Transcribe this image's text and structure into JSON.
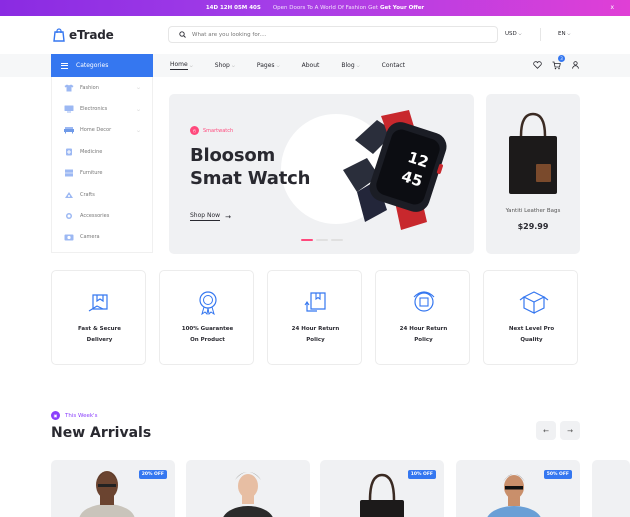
{
  "promo": {
    "countdown": "14D 12H 05M 40S",
    "message": "Open Doors To A World Of Fashion Get",
    "offer": "Get Your Offer",
    "close": "x"
  },
  "header": {
    "logo": "eTrade",
    "search_placeholder": "What are you looking for....",
    "currency": "USD",
    "language": "EN"
  },
  "nav": {
    "categories_label": "Categories",
    "items": [
      {
        "label": "Home",
        "dropdown": true
      },
      {
        "label": "Shop",
        "dropdown": true
      },
      {
        "label": "Pages",
        "dropdown": true
      },
      {
        "label": "About",
        "dropdown": false
      },
      {
        "label": "Blog",
        "dropdown": true
      },
      {
        "label": "Contact",
        "dropdown": false
      }
    ],
    "cart_count": "3"
  },
  "sidebar": {
    "items": [
      {
        "label": "Fashion",
        "icon": "shirt-icon",
        "dropdown": true
      },
      {
        "label": "Electronics",
        "icon": "tv-icon",
        "dropdown": true
      },
      {
        "label": "Home Decor",
        "icon": "sofa-icon",
        "dropdown": true
      },
      {
        "label": "Medicine",
        "icon": "medicine-icon",
        "dropdown": false
      },
      {
        "label": "Furniture",
        "icon": "furniture-icon",
        "dropdown": false
      },
      {
        "label": "Crafts",
        "icon": "crafts-icon",
        "dropdown": false
      },
      {
        "label": "Accessories",
        "icon": "accessories-icon",
        "dropdown": false
      },
      {
        "label": "Camera",
        "icon": "camera-icon",
        "dropdown": false
      }
    ]
  },
  "hero": {
    "tag": "Smartwatch",
    "title": "Bloosom Smat Watch",
    "cta": "Shop Now",
    "watch_time_top": "12",
    "watch_time_bottom": "45"
  },
  "side_product": {
    "name": "Yantiti Leather Bags",
    "price": "$29.99"
  },
  "features": [
    {
      "line1": "Fast & Secure",
      "line2": "Delivery",
      "icon": "delivery-box-icon"
    },
    {
      "line1": "100% Guarantee",
      "line2": "On Product",
      "icon": "guarantee-badge-icon"
    },
    {
      "line1": "24 Hour Return",
      "line2": "Policy",
      "icon": "return-box-icon"
    },
    {
      "line1": "24 Hour Return",
      "line2": "Policy",
      "icon": "return-headset-icon"
    },
    {
      "line1": "Next Level Pro",
      "line2": "Quality",
      "icon": "quality-box-icon"
    }
  ],
  "arrivals": {
    "eyebrow": "This Week's",
    "title": "New Arrivals",
    "prev": "←",
    "next": "→",
    "products": [
      {
        "discount": "20% OFF"
      },
      {
        "discount": ""
      },
      {
        "discount": "10% OFF"
      },
      {
        "discount": "50% OFF"
      }
    ]
  },
  "colors": {
    "primary": "#3577f0",
    "accent_pink": "#ff497c",
    "accent_purple": "#8a3ffc"
  }
}
